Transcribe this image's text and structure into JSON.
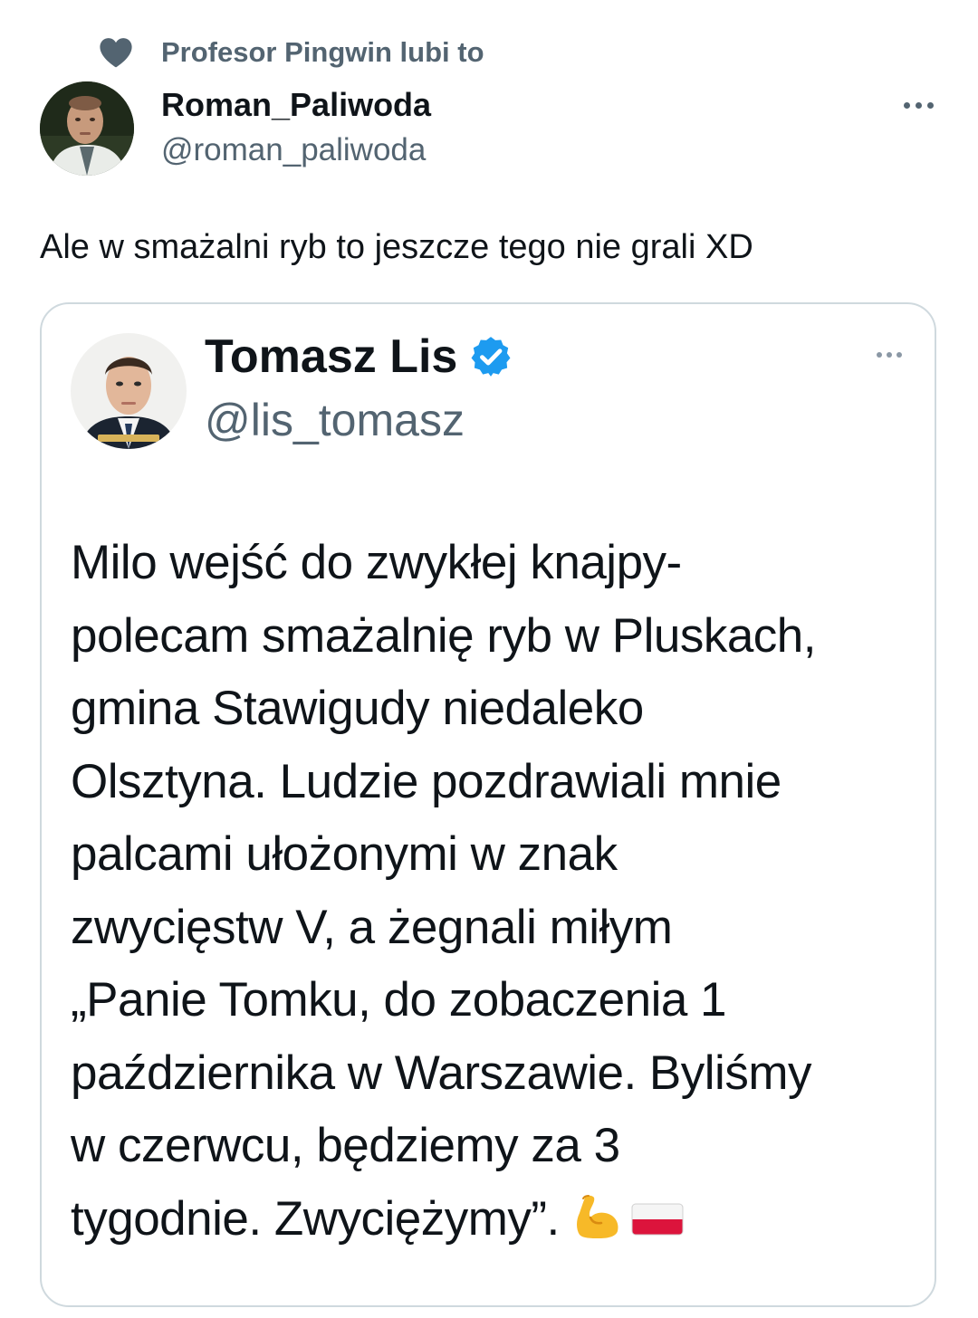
{
  "liked_by": {
    "text": "Profesor Pingwin lubi to"
  },
  "author": {
    "name": "Roman_Paliwoda",
    "handle": "@roman_paliwoda"
  },
  "tweet": {
    "text": "Ale w smażalni ryb to jeszcze tego nie grali XD"
  },
  "quoted": {
    "name": "Tomasz Lis",
    "handle": "@lis_tomasz",
    "verified": true,
    "body_lines": [
      "Milo wejść do zwykłej knajpy-",
      "polecam smażalnię ryb w Pluskach,",
      "gmina Stawigudy niedaleko",
      "Olsztyna. Ludzie pozdrawiali mnie",
      "palcami ułożonymi w znak",
      "zwycięstw V, a żegnali miłym",
      "„Panie Tomku, do zobaczenia 1",
      "października w Warszawie. Byliśmy",
      "w czerwcu, będziemy za 3",
      "tygodnie. Zwyciężymy”."
    ],
    "emojis": [
      "flexed-biceps",
      "flag-poland"
    ]
  },
  "icons": {
    "liked": "heart-icon",
    "more": "more-icon",
    "verified": "verified-badge-icon"
  },
  "colors": {
    "text_primary": "#0f1419",
    "text_secondary": "#536471",
    "verified_blue": "#1d9bf0",
    "border": "#cfd9de"
  }
}
